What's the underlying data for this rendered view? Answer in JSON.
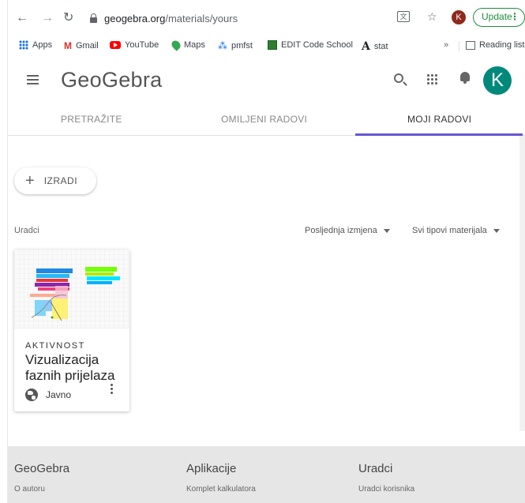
{
  "browser": {
    "url_host": "geogebra.org",
    "url_path": "/materials/yours",
    "profile_initial": "K",
    "update_label": "Update",
    "bookmarks": [
      {
        "label": "Apps",
        "icon": "apps-grid-icon"
      },
      {
        "label": "Gmail",
        "icon": "gmail-icon"
      },
      {
        "label": "YouTube",
        "icon": "youtube-icon"
      },
      {
        "label": "Maps",
        "icon": "maps-icon"
      },
      {
        "label": "pmfst",
        "icon": "pmfst-icon"
      },
      {
        "label": "EDIT Code School",
        "icon": "edit-code-school-icon"
      },
      {
        "label": "stat",
        "icon": "stat-icon"
      }
    ],
    "overflow_label": "»",
    "reading_list_label": "Reading list"
  },
  "header": {
    "logo": "GeoGebra",
    "avatar_initial": "K",
    "avatar_color": "#00897b"
  },
  "tabs": [
    {
      "label": "PRETRAŽITE",
      "active": false
    },
    {
      "label": "OMILJENI RADOVI",
      "active": false
    },
    {
      "label": "MOJI RADOVI",
      "active": true
    }
  ],
  "accent_color": "#6557d2",
  "main": {
    "create_label": "IZRADI",
    "section_label": "Uradci",
    "sort_label": "Posljednja izmjena",
    "filter_label": "Svi tipovi materijala"
  },
  "card": {
    "type": "AKTIVNOST",
    "title": "Vizualizacija faznih prijelaza",
    "visibility": "Javno"
  },
  "footer": {
    "columns": [
      {
        "title": "GeoGebra",
        "link": "O autoru"
      },
      {
        "title": "Aplikacije",
        "link": "Komplet kalkulatora"
      },
      {
        "title": "Uradci",
        "link": "Uradci korisnika"
      }
    ]
  }
}
